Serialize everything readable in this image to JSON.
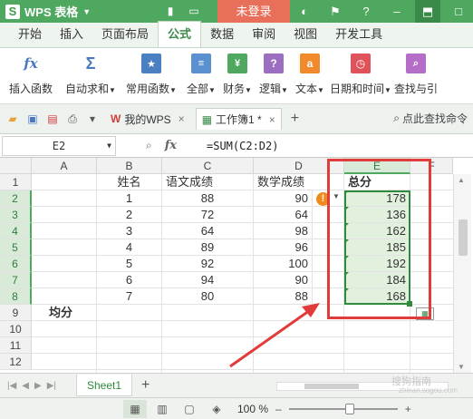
{
  "titlebar": {
    "app_name": "WPS 表格",
    "login": "未登录",
    "icons": [
      "menu-icon",
      "folder-icon",
      "window-icon",
      "skin-icon",
      "pin-icon",
      "help-icon",
      "minimize-icon",
      "maximize-icon"
    ]
  },
  "menu": {
    "tabs": [
      "开始",
      "插入",
      "页面布局",
      "公式",
      "数据",
      "审阅",
      "视图",
      "开发工具"
    ],
    "active": "公式"
  },
  "ribbon": {
    "items": [
      {
        "label": "插入函数",
        "icon": "fx-icon"
      },
      {
        "label": "自动求和",
        "icon": "sigma-icon"
      },
      {
        "label": "常用函数",
        "icon": "star-book-icon"
      },
      {
        "label": "全部",
        "icon": "book-icon"
      },
      {
        "label": "财务",
        "icon": "finance-icon"
      },
      {
        "label": "逻辑",
        "icon": "logic-icon"
      },
      {
        "label": "文本",
        "icon": "text-icon"
      },
      {
        "label": "日期和时间",
        "icon": "clock-icon"
      },
      {
        "label": "查找与引",
        "icon": "lookup-icon"
      }
    ]
  },
  "tabs": {
    "doc1": "我的WPS",
    "doc2": "工作簿1 *",
    "search": "点此查找命令"
  },
  "formulabar": {
    "namebox": "E2",
    "fx": "fx",
    "formula": "=SUM(C2:D2)"
  },
  "sheet": {
    "columns": [
      "A",
      "B",
      "C",
      "D",
      "E",
      "F"
    ],
    "rows": [
      "1",
      "2",
      "3",
      "4",
      "5",
      "6",
      "7",
      "8",
      "9",
      "10",
      "11",
      "12"
    ],
    "header": {
      "B": "姓名",
      "C": "语文成绩",
      "D": "数学成绩",
      "E": "总分"
    },
    "data": [
      {
        "B": "1",
        "C": "88",
        "D": "90",
        "E": "178"
      },
      {
        "B": "2",
        "C": "72",
        "D": "64",
        "E": "136"
      },
      {
        "B": "3",
        "C": "64",
        "D": "98",
        "E": "162"
      },
      {
        "B": "4",
        "C": "89",
        "D": "96",
        "E": "185"
      },
      {
        "B": "5",
        "C": "92",
        "D": "100",
        "E": "192"
      },
      {
        "B": "6",
        "C": "94",
        "D": "90",
        "E": "184"
      },
      {
        "B": "7",
        "C": "80",
        "D": "88",
        "E": "168"
      }
    ],
    "avg_label": "均分"
  },
  "sheetbar": {
    "tab": "Sheet1"
  },
  "status": {
    "zoom": "100 %"
  },
  "watermark": {
    "text": "搜狗指南",
    "url": "zhinan.sogou.com"
  }
}
